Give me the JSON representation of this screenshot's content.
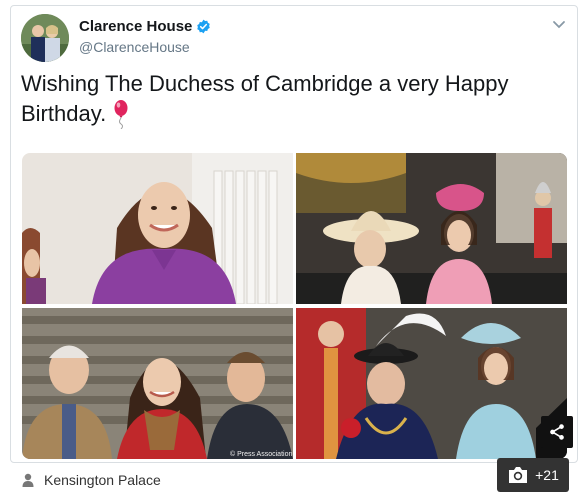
{
  "tweet": {
    "account_name": "Clarence House",
    "handle": "@ClarenceHouse",
    "text": "Wishing The Duchess of Cambridge a very Happy Birthday.",
    "verified": true,
    "photo_credit": "© Press Association"
  },
  "article_footer": {
    "author": "Kensington Palace",
    "gallery_count": "+21"
  },
  "icons": {
    "verified": "verified-badge-icon",
    "menu": "chevron-down-icon",
    "emoji": "balloon-icon",
    "share": "share-icon",
    "author": "person-icon",
    "gallery": "camera-icon"
  },
  "colors": {
    "verified_blue": "#1da1f2",
    "text_primary": "#14171a",
    "text_secondary": "#657786",
    "balloon_red": "#e0245e"
  }
}
